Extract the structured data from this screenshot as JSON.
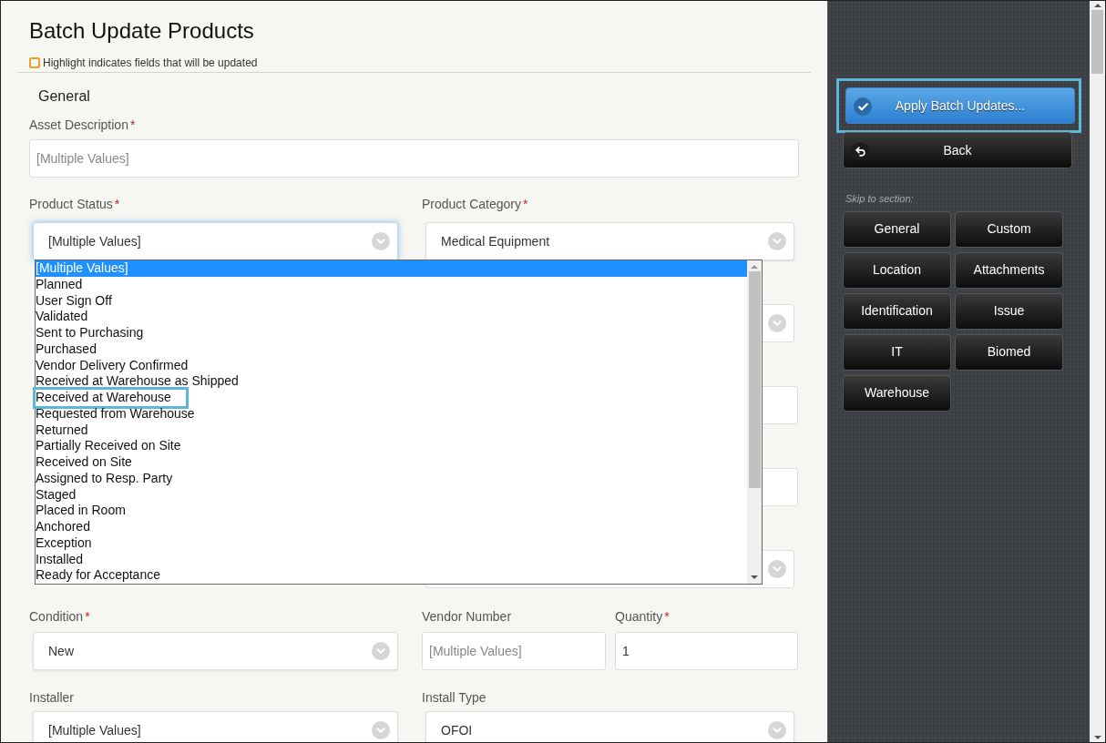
{
  "title": "Batch Update Products",
  "legend": {
    "text": "Highlight indicates fields that will be updated",
    "checked": false
  },
  "section": "General",
  "asset_description": {
    "label": "Asset Description",
    "required_mark": "*",
    "placeholder": "[Multiple Values]"
  },
  "status_row": [
    {
      "label": "Product Status",
      "required_mark": "*",
      "kind": "select",
      "value": "[Multiple Values]",
      "focused": true
    },
    {
      "label": "Product Category",
      "required_mark": "*",
      "kind": "select",
      "value": "Medical Equipment",
      "focused": false
    }
  ],
  "covered_rows": [
    {
      "kind": "select"
    },
    {
      "kind": "input"
    },
    {
      "kind": "input"
    },
    {
      "kind": "select"
    }
  ],
  "status_options": [
    {
      "label": "[Multiple Values]",
      "selected": true,
      "focused": false
    },
    {
      "label": "Planned",
      "selected": false,
      "focused": false
    },
    {
      "label": "User Sign Off",
      "selected": false,
      "focused": false
    },
    {
      "label": "Validated",
      "selected": false,
      "focused": false
    },
    {
      "label": "Sent to Purchasing",
      "selected": false,
      "focused": false
    },
    {
      "label": "Purchased",
      "selected": false,
      "focused": false
    },
    {
      "label": "Vendor Delivery Confirmed",
      "selected": false,
      "focused": false
    },
    {
      "label": "Received at Warehouse as Shipped",
      "selected": false,
      "focused": false
    },
    {
      "label": "Received at Warehouse",
      "selected": false,
      "focused": true
    },
    {
      "label": "Requested from Warehouse",
      "selected": false,
      "focused": false
    },
    {
      "label": "Returned",
      "selected": false,
      "focused": false
    },
    {
      "label": "Partially Received on Site",
      "selected": false,
      "focused": false
    },
    {
      "label": "Received on Site",
      "selected": false,
      "focused": false
    },
    {
      "label": "Assigned to Resp. Party",
      "selected": false,
      "focused": false
    },
    {
      "label": "Staged",
      "selected": false,
      "focused": false
    },
    {
      "label": "Placed in Room",
      "selected": false,
      "focused": false
    },
    {
      "label": "Anchored",
      "selected": false,
      "focused": false
    },
    {
      "label": "Exception",
      "selected": false,
      "focused": false
    },
    {
      "label": "Installed",
      "selected": false,
      "focused": false
    },
    {
      "label": "Ready for Acceptance",
      "selected": false,
      "focused": false
    }
  ],
  "condition": {
    "label": "Condition",
    "required_mark": "*",
    "value": "New"
  },
  "vendor_number": {
    "label": "Vendor Number",
    "placeholder": "[Multiple Values]"
  },
  "quantity": {
    "label": "Quantity",
    "required_mark": "*",
    "value": "1"
  },
  "install_row": [
    {
      "label": "Installer",
      "value": "[Multiple Values]"
    },
    {
      "label": "Install Type",
      "value": "OFOI"
    }
  ],
  "sidebar": {
    "apply": "Apply Batch Updates...",
    "apply_focused": true,
    "back": "Back",
    "skip_label": "Skip to section:",
    "sections": [
      "General",
      "Custom",
      "Location",
      "Attachments",
      "Identification",
      "Issue",
      "IT",
      "Biomed",
      "Warehouse"
    ]
  }
}
